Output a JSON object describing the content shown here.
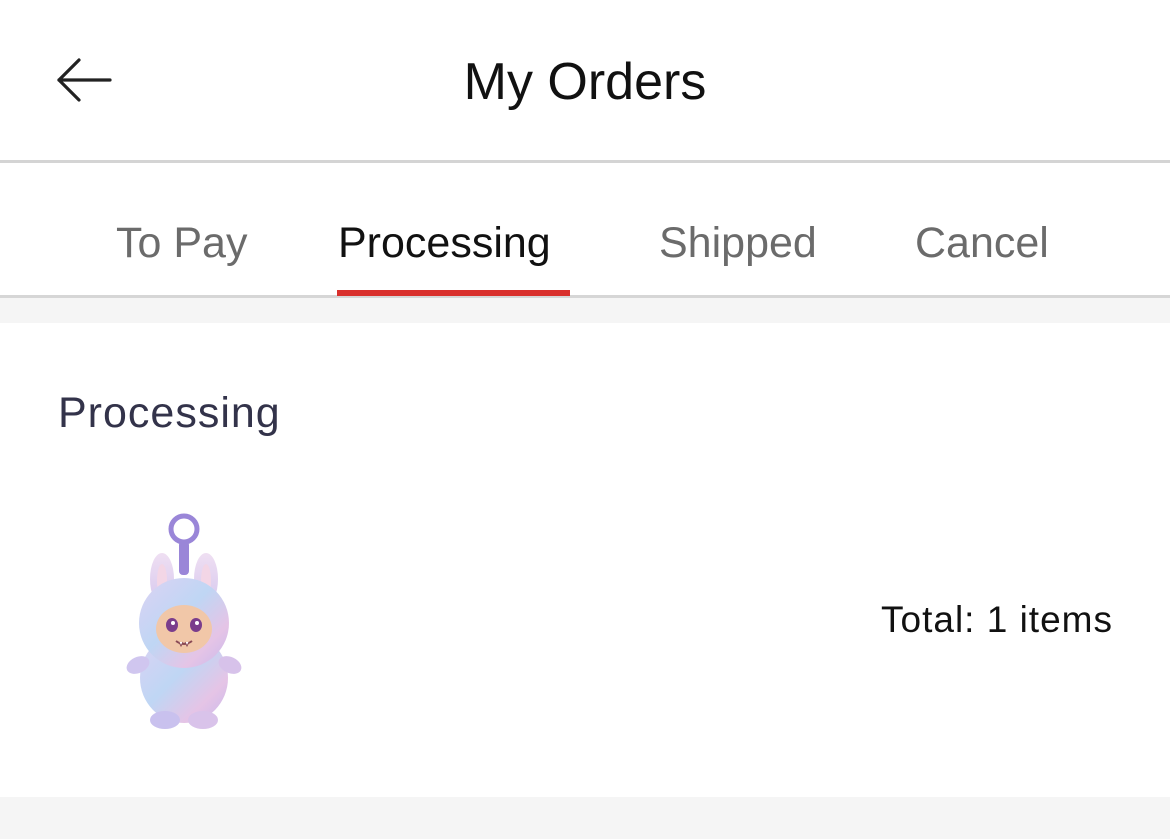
{
  "header": {
    "back_icon": "arrow-left-icon",
    "title": "My Orders"
  },
  "tabs": [
    {
      "label": "To Pay",
      "active": false
    },
    {
      "label": "Processing",
      "active": true
    },
    {
      "label": "Shipped",
      "active": false
    },
    {
      "label": "Cancel",
      "active": false
    }
  ],
  "colors": {
    "accent": "#d9302c",
    "background": "#f5f5f5",
    "tab_inactive": "#6b6b6b",
    "text_primary": "#111111"
  },
  "orders": [
    {
      "status": "Processing",
      "product_image": "pastel-plush-bunny-keychain-toy",
      "total": "Total: 1 items"
    }
  ]
}
